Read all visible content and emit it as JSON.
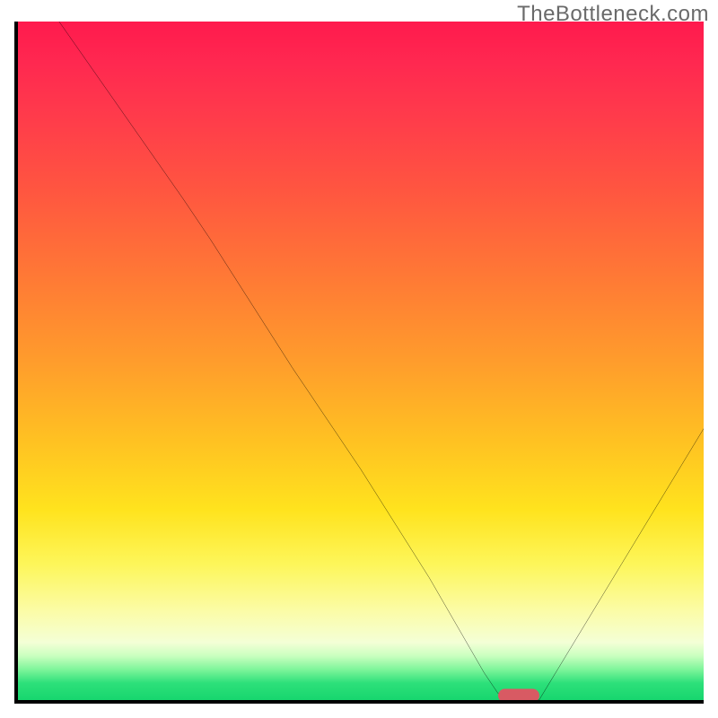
{
  "watermark": "TheBottleneck.com",
  "colors": {
    "axis": "#000000",
    "curve": "#000000",
    "marker": "#d85a63",
    "gradient_top": "#ff1a4d",
    "gradient_mid": "#ffe31e",
    "gradient_bottom": "#17d66e"
  },
  "chart_data": {
    "type": "line",
    "title": "",
    "xlabel": "",
    "ylabel": "",
    "xlim": [
      0,
      100
    ],
    "ylim": [
      0,
      100
    ],
    "grid": false,
    "legend": false,
    "background": "red-to-green vertical gradient (bottleneck heatmap)",
    "series": [
      {
        "name": "bottleneck-curve",
        "x": [
          6,
          15,
          24,
          28,
          40,
          50,
          60,
          68,
          70,
          73,
          76,
          88,
          100
        ],
        "values": [
          100,
          87,
          74,
          68,
          49,
          34,
          18,
          4,
          1,
          0,
          0,
          20,
          40
        ]
      }
    ],
    "annotations": [
      {
        "name": "min-marker",
        "x": 73,
        "y": 0.7,
        "shape": "pill",
        "color": "#d85a63"
      }
    ]
  }
}
